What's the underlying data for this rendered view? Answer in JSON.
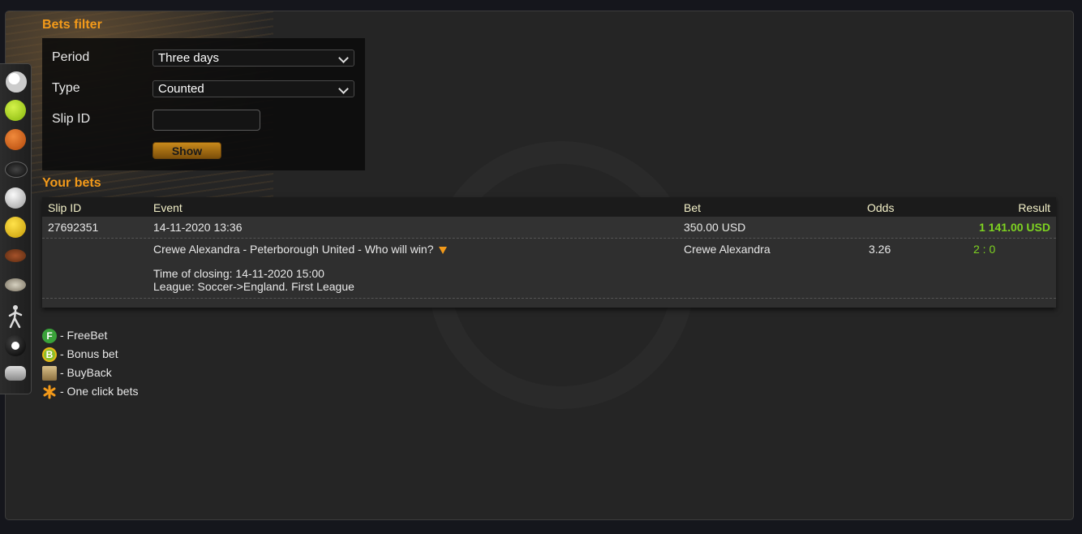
{
  "filter": {
    "title": "Bets filter",
    "period_label": "Period",
    "period_value": "Three days",
    "type_label": "Type",
    "type_value": "Counted",
    "slip_label": "Slip ID",
    "slip_value": "",
    "show_button": "Show"
  },
  "bets": {
    "title": "Your bets",
    "columns": [
      "Slip ID",
      "Event",
      "Bet",
      "Odds",
      "Result"
    ],
    "row": {
      "slip_id": "27692351",
      "date": "14-11-2020 13:36",
      "bet": "350.00 USD",
      "result": "1 141.00 USD",
      "event": "Crewe Alexandra - Peterborough United - Who will win?",
      "selection": "Crewe Alexandra",
      "odds": "3.26",
      "score": "2 : 0",
      "closing": "Time of closing: 14-11-2020 15:00",
      "league": "League: Soccer->England. First League"
    }
  },
  "legend": [
    {
      "icon": "freebet-icon",
      "label": "- FreeBet",
      "letter": "F",
      "color": "#3aa23a"
    },
    {
      "icon": "bonus-icon",
      "label": "- Bonus bet",
      "letter": "B",
      "color": "#8bbf2a"
    },
    {
      "icon": "buyback-icon",
      "label": "- BuyBack"
    },
    {
      "icon": "one-click-icon",
      "label": "- One click bets"
    }
  ],
  "sidebar": {
    "sports": [
      "soccer-icon",
      "tennis-icon",
      "basketball-icon",
      "hockey-puck-icon",
      "volleyball-icon",
      "water-polo-icon",
      "american-football-icon",
      "rugby-icon",
      "athletics-icon",
      "billiards-icon",
      "esports-gamepad-icon"
    ]
  },
  "colors": {
    "accent": "#f39a1a",
    "win": "#7ed321",
    "header_text": "#f3f0c8"
  }
}
